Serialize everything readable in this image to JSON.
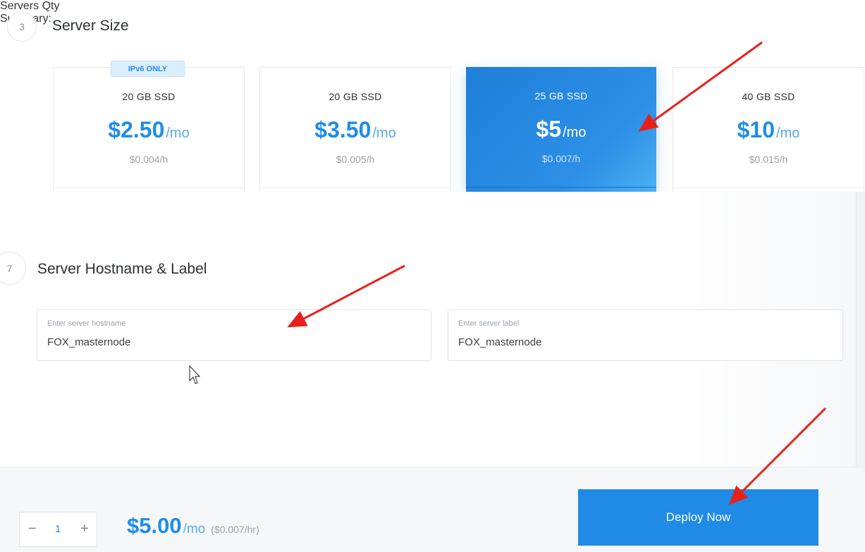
{
  "server_size": {
    "step": "3",
    "title": "Server Size",
    "plans": [
      {
        "badge": "IPv6 ONLY",
        "storage": "20 GB SSD",
        "price": "$2.50",
        "per": "/mo",
        "hourly": "$0.004/h",
        "selected": false
      },
      {
        "storage": "20 GB SSD",
        "price": "$3.50",
        "per": "/mo",
        "hourly": "$0.005/h",
        "selected": false
      },
      {
        "storage": "25 GB SSD",
        "price": "$5",
        "per": "/mo",
        "hourly": "$0.007/h",
        "selected": true
      },
      {
        "storage": "40 GB SSD",
        "price": "$10",
        "per": "/mo",
        "hourly": "$0.015/h",
        "selected": false
      }
    ]
  },
  "hostname": {
    "step": "7",
    "title": "Server Hostname & Label",
    "hostname_field": {
      "label": "Enter server hostname",
      "value": "FOX_masternode"
    },
    "label_field": {
      "label": "Enter server label",
      "value": "FOX_masternode"
    }
  },
  "footer": {
    "qty_label": "Servers Qty",
    "qty_minus": "−",
    "qty_value": "1",
    "qty_plus": "+",
    "summary_label": "Summary:",
    "total_price": "$5.00",
    "total_per": "/mo",
    "total_hourly": "($0.007/hr)",
    "deploy_label": "Deploy Now"
  },
  "colors": {
    "accent": "#1f8de8",
    "annotation_arrow": "#e8201a"
  }
}
